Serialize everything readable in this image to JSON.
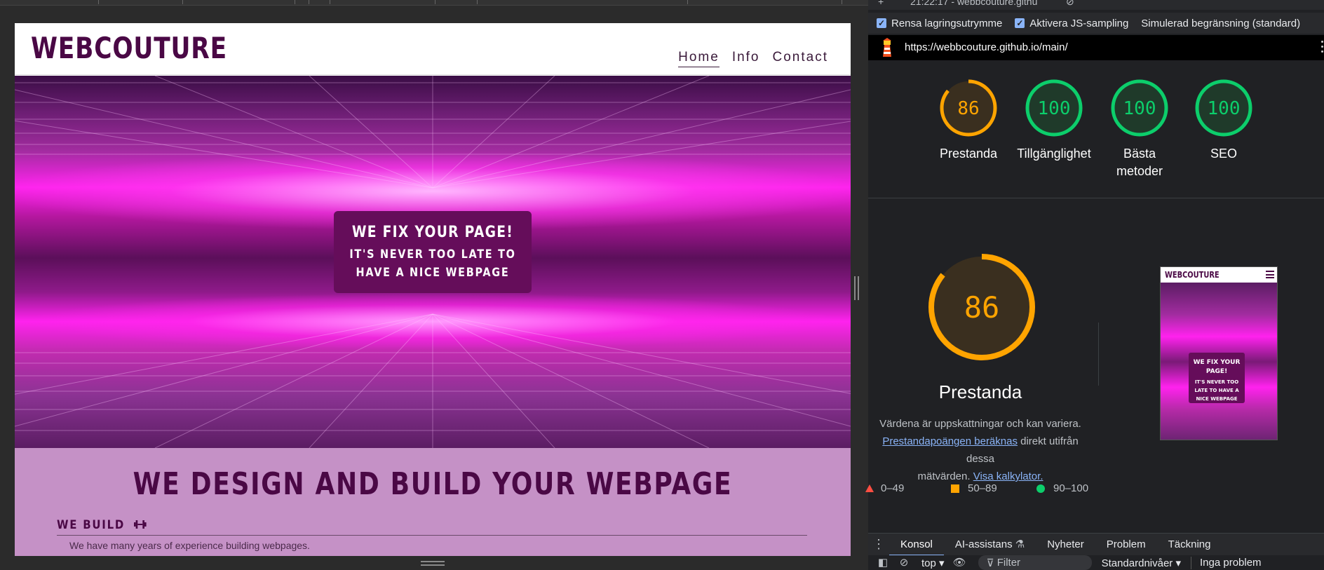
{
  "site": {
    "logo": "WEBCOUTURE",
    "nav": [
      "Home",
      "Info",
      "Contact"
    ],
    "hero_title": "WE FIX YOUR PAGE!",
    "hero_sub_1": "IT'S NEVER TOO LATE TO",
    "hero_sub_2": "HAVE A NICE WEBPAGE",
    "section_title": "WE DESIGN AND BUILD YOUR WEBPAGE",
    "subhead": "WE BUILD",
    "subhead_icon": "dumbbell-icon",
    "body_text": "We have many years of experience building webpages."
  },
  "devtools": {
    "tab_title": "21:22:17 - webbcouture.githu",
    "options": {
      "clear_storage": "Rensa lagringsutrymme",
      "js_sampling": "Aktivera JS-sampling",
      "throttling": "Simulerad begränsning (standard)"
    },
    "url": "https://webbcouture.github.io/main/",
    "scores": [
      {
        "value": "86",
        "label": "Prestanda",
        "status": "average"
      },
      {
        "value": "100",
        "label": "Tillgänglighet",
        "status": "pass"
      },
      {
        "value": "100",
        "label": "Bästa",
        "label2": "metoder",
        "status": "pass"
      },
      {
        "value": "100",
        "label": "SEO",
        "status": "pass"
      }
    ],
    "main_score": {
      "value": "86",
      "label": "Prestanda"
    },
    "description": {
      "line1": "Värdena är uppskattningar och kan variera.",
      "link1": "Prestandapoängen beräknas",
      "line2": " direkt utifrån dessa",
      "line3": "mätvärden. ",
      "link2": "Visa kalkylator."
    },
    "thumbnail": {
      "logo": "WEBCOUTURE",
      "title_1": "WE FIX YOUR",
      "title_2": "PAGE!",
      "sub_1": "IT'S NEVER TOO",
      "sub_2": "LATE TO HAVE A",
      "sub_3": "NICE WEBPAGE"
    },
    "legend": {
      "fail": "0–49",
      "average": "50–89",
      "pass": "90–100"
    },
    "drawer_tabs": [
      "Konsol",
      "AI-assistans",
      "Nyheter",
      "Problem",
      "Täckning"
    ],
    "console": {
      "context": "top",
      "filter_placeholder": "Filter",
      "levels": "Standardnivåer",
      "issues": "Inga problem"
    },
    "colors": {
      "average": "#ffa400",
      "pass": "#0cce6b",
      "fail": "#ff4e42",
      "link": "#8ab4f8"
    }
  }
}
